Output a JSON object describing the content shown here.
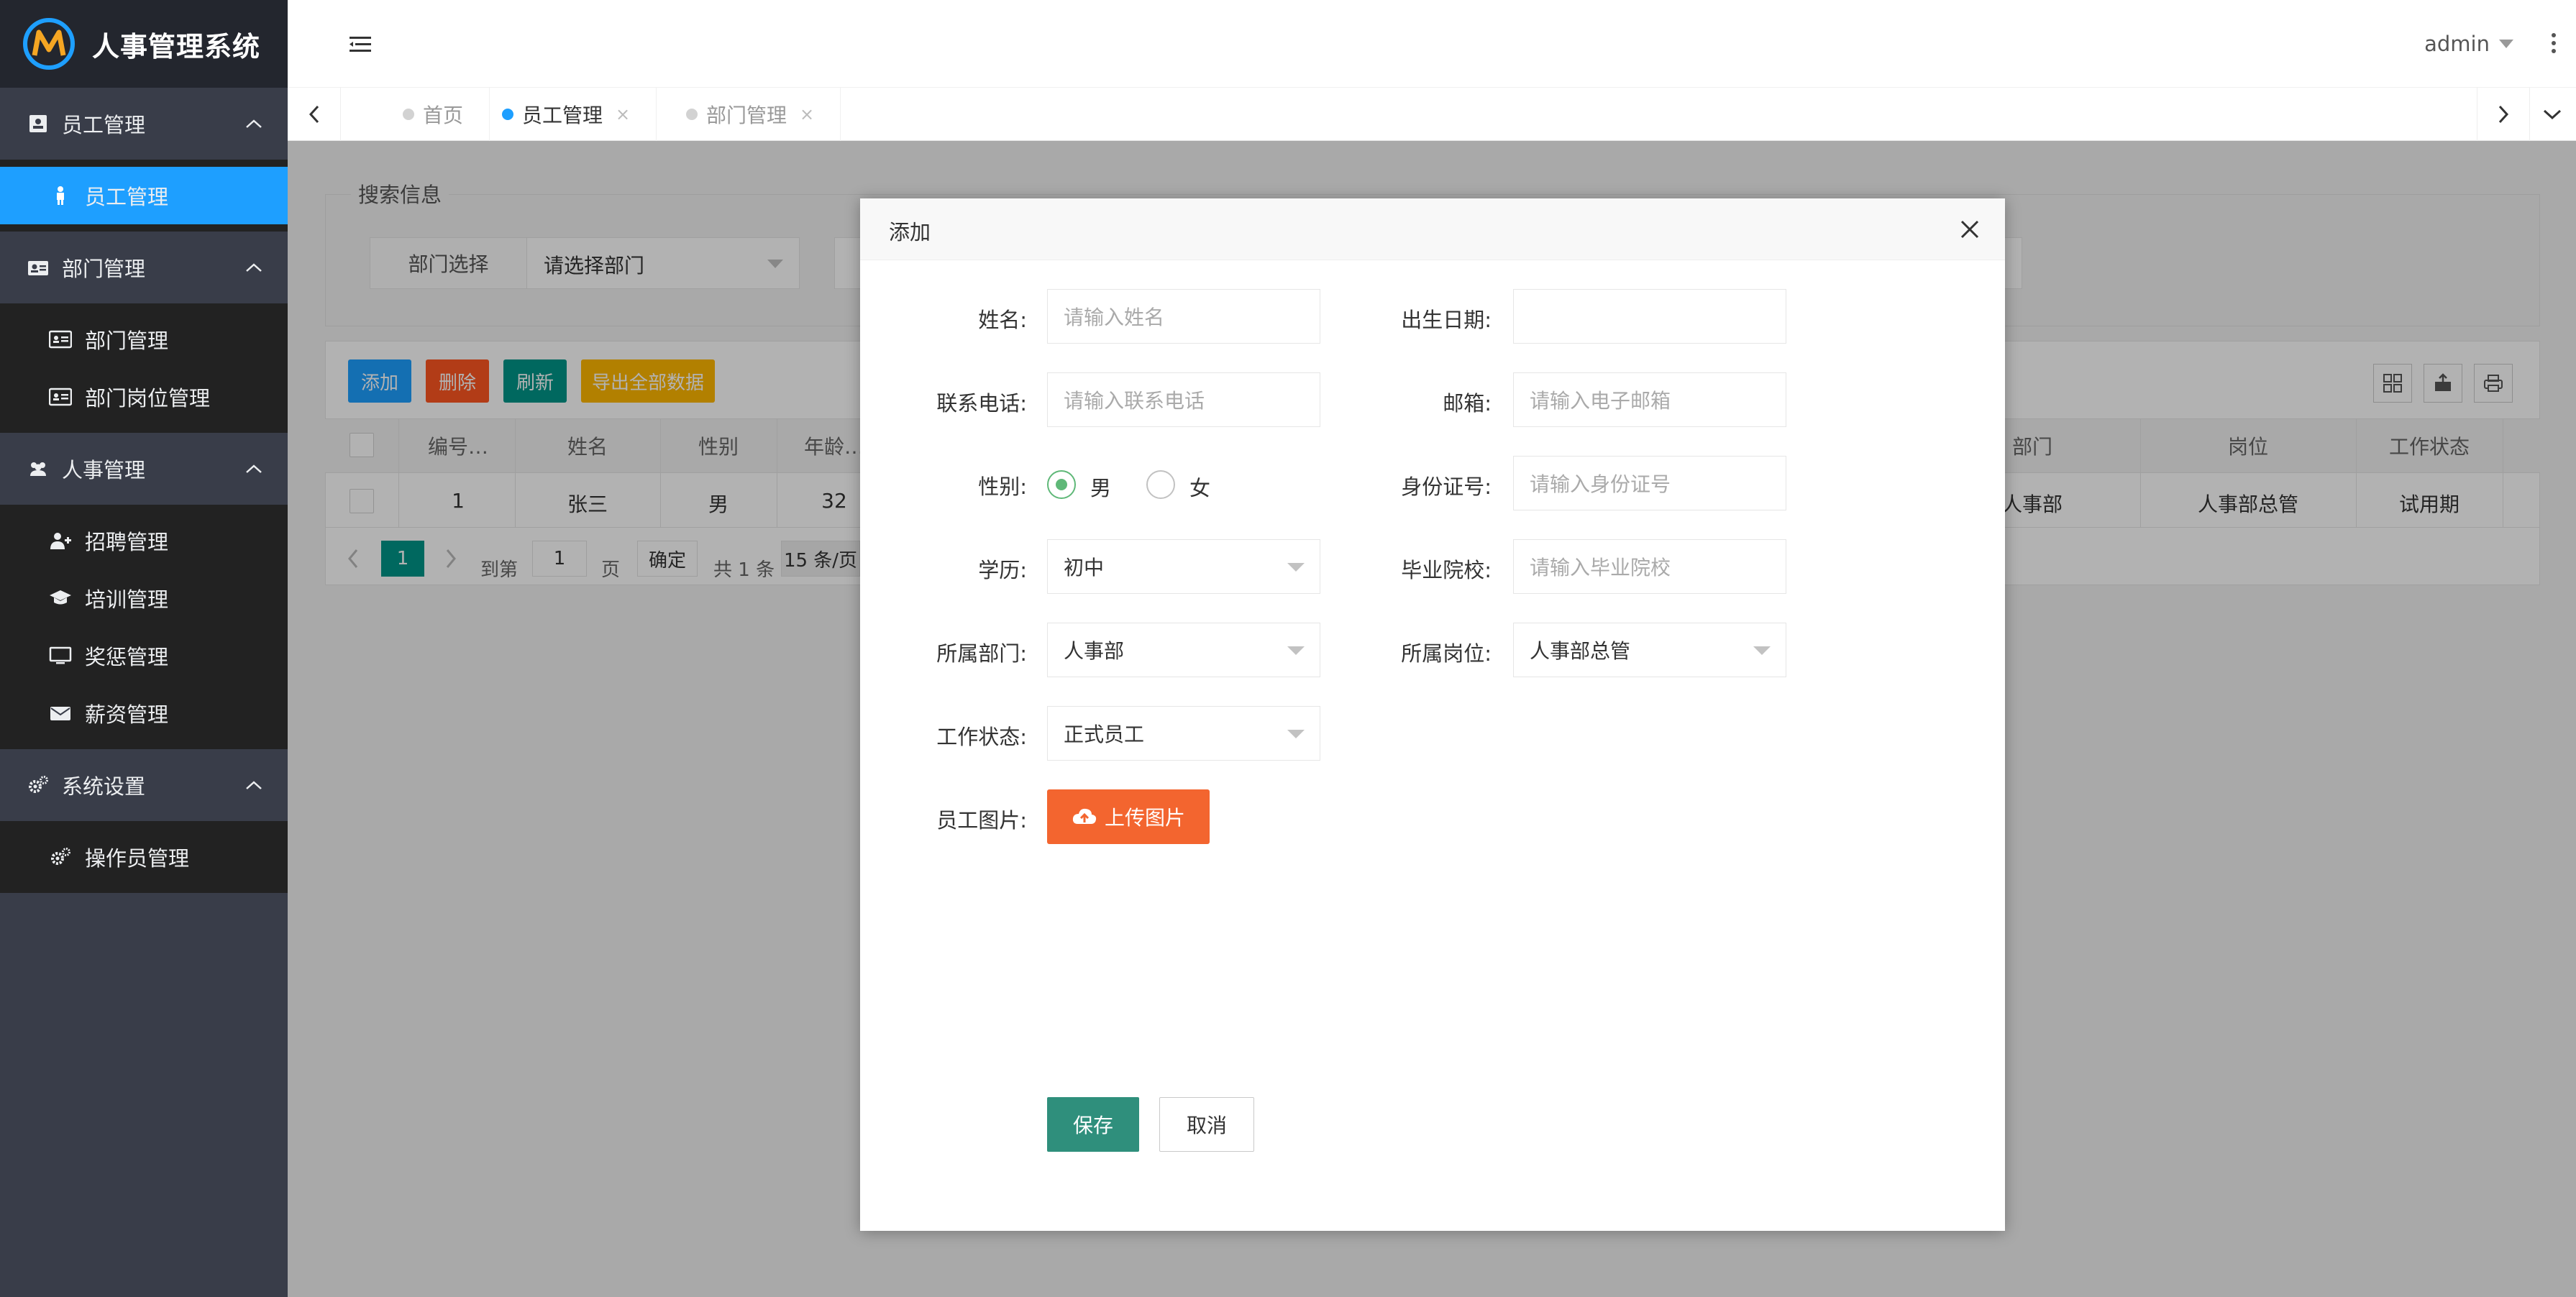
{
  "app": {
    "title": "人事管理系统"
  },
  "sidebar": {
    "groups": [
      {
        "label": "员工管理",
        "items": [
          {
            "label": "员工管理",
            "active": true
          }
        ]
      },
      {
        "label": "部门管理",
        "items": [
          {
            "label": "部门管理"
          },
          {
            "label": "部门岗位管理"
          }
        ]
      },
      {
        "label": "人事管理",
        "items": [
          {
            "label": "招聘管理"
          },
          {
            "label": "培训管理"
          },
          {
            "label": "奖惩管理"
          },
          {
            "label": "薪资管理"
          }
        ]
      },
      {
        "label": "系统设置",
        "items": [
          {
            "label": "操作员管理"
          }
        ]
      }
    ]
  },
  "header": {
    "user": "admin"
  },
  "tabs": [
    {
      "label": "首页"
    },
    {
      "label": "员工管理",
      "active": true,
      "close": "×"
    },
    {
      "label": "部门管理",
      "close": "×"
    }
  ],
  "search": {
    "legend": "搜索信息",
    "dept_label": "部门选择",
    "dept_value": "请选择部门"
  },
  "toolbar": {
    "add": "添加",
    "delete": "删除",
    "refresh": "刷新",
    "export": "导出全部数据"
  },
  "table": {
    "columns": [
      "编号…",
      "姓名",
      "性别",
      "年龄…",
      "部门",
      "岗位",
      "工作状态"
    ],
    "rows": [
      {
        "id": "1",
        "name": "张三",
        "gender": "男",
        "age": "32",
        "dept": "人事部",
        "post": "人事部总管",
        "status": "试用期"
      }
    ]
  },
  "pager": {
    "page": "1",
    "goto_label": "到第",
    "goto_value": "1",
    "page_unit": "页",
    "confirm": "确定",
    "total": "共 1 条",
    "per_page": "15 条/页"
  },
  "dialog": {
    "title": "添加",
    "fields": {
      "name": {
        "label": "姓名:",
        "placeholder": "请输入姓名"
      },
      "birth": {
        "label": "出生日期:",
        "value": ""
      },
      "phone": {
        "label": "联系电话:",
        "placeholder": "请输入联系电话"
      },
      "email": {
        "label": "邮箱:",
        "placeholder": "请输入电子邮箱"
      },
      "gender": {
        "label": "性别:",
        "options": [
          "男",
          "女"
        ],
        "selected": "男"
      },
      "idcard": {
        "label": "身份证号:",
        "placeholder": "请输入身份证号"
      },
      "education": {
        "label": "学历:",
        "value": "初中"
      },
      "school": {
        "label": "毕业院校:",
        "placeholder": "请输入毕业院校"
      },
      "dept": {
        "label": "所属部门:",
        "value": "人事部"
      },
      "post": {
        "label": "所属岗位:",
        "value": "人事部总管"
      },
      "status": {
        "label": "工作状态:",
        "value": "正式员工"
      },
      "photo": {
        "label": "员工图片:",
        "button": "上传图片"
      }
    },
    "save": "保存",
    "cancel": "取消"
  },
  "colors": {
    "sidebar": "#393d49",
    "active_blue": "#1e9fff",
    "save_green": "#2f8f7c",
    "upload_orange": "#f3652f"
  }
}
